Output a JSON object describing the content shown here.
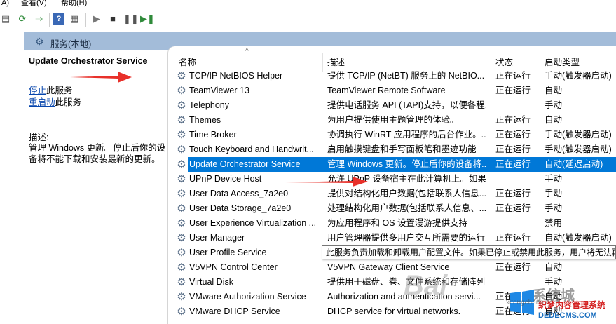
{
  "menu": {
    "action": "A)",
    "view": "查看(V)",
    "help": "帮助(H)"
  },
  "panel": {
    "header_title": "服务(本地)",
    "selected_service": "Update Orchestrator Service",
    "stop_link": "停止",
    "stop_suffix": "此服务",
    "restart_link": "重启动",
    "restart_suffix": "此服务",
    "desc_label": "描述:",
    "desc_text": "管理 Windows 更新。停止后你的设备将不能下载和安装最新的更新。"
  },
  "columns": {
    "name": "名称",
    "desc": "描述",
    "status": "状态",
    "startup": "启动类型"
  },
  "services": [
    {
      "name": "TCP/IP NetBIOS Helper",
      "desc": "提供 TCP/IP (NetBT) 服务上的 NetBIO...",
      "status": "正在运行",
      "startup": "手动(触发器启动)"
    },
    {
      "name": "TeamViewer 13",
      "desc": "TeamViewer Remote Software",
      "status": "正在运行",
      "startup": "自动"
    },
    {
      "name": "Telephony",
      "desc": "提供电话服务 API (TAPI)支持，以便各程...",
      "status": "",
      "startup": "手动"
    },
    {
      "name": "Themes",
      "desc": "为用户提供使用主题管理的体验。",
      "status": "正在运行",
      "startup": "自动"
    },
    {
      "name": "Time Broker",
      "desc": "协调执行 WinRT 应用程序的后台作业。...",
      "status": "正在运行",
      "startup": "手动(触发器启动)"
    },
    {
      "name": "Touch Keyboard and Handwrit...",
      "desc": "启用触摸键盘和手写面板笔和墨迹功能",
      "status": "正在运行",
      "startup": "手动(触发器启动)"
    },
    {
      "name": "Update Orchestrator Service",
      "desc": "管理 Windows 更新。停止后你的设备将...",
      "status": "正在运行",
      "startup": "自动(延迟启动)"
    },
    {
      "name": "UPnP Device Host",
      "desc": "允许 UPnP 设备宿主在此计算机上。如果...",
      "status": "",
      "startup": "手动"
    },
    {
      "name": "User Data Access_7a2e0",
      "desc": "提供对结构化用户数据(包括联系人信息...",
      "status": "正在运行",
      "startup": "手动"
    },
    {
      "name": "User Data Storage_7a2e0",
      "desc": "处理结构化用户数据(包括联系人信息、...",
      "status": "正在运行",
      "startup": "手动"
    },
    {
      "name": "User Experience Virtualization ...",
      "desc": "为应用程序和 OS 设置漫游提供支持",
      "status": "",
      "startup": "禁用"
    },
    {
      "name": "User Manager",
      "desc": "用户管理器提供多用户交互所需要的运行...",
      "status": "正在运行",
      "startup": "自动(触发器启动)"
    },
    {
      "name": "User Profile Service",
      "desc": "",
      "status": "",
      "startup": ""
    },
    {
      "name": "V5VPN Control Center",
      "desc": "V5VPN Gateway Client Service",
      "status": "正在运行",
      "startup": "自动"
    },
    {
      "name": "Virtual Disk",
      "desc": "提供用于磁盘、卷、文件系统和存储阵列...",
      "status": "",
      "startup": "手动"
    },
    {
      "name": "VMware Authorization Service",
      "desc": "Authorization and authentication servi...",
      "status": "正在运行",
      "startup": "自动"
    },
    {
      "name": "VMware DHCP Service",
      "desc": "DHCP service for virtual networks.",
      "status": "正在运行",
      "startup": "自动"
    }
  ],
  "tooltip": "此服务负责加载和卸载用户配置文件。如果已停止或禁用此服务，用户将无法再",
  "watermark": {
    "baidu": "Bai",
    "xitong": "系统城",
    "site1": "织梦内容管理系统",
    "site2": "DEDECMS.COM",
    "sub": "xitongcheng.com"
  },
  "colors": {
    "header_bar": "#a3bcd9",
    "selection": "#0078d7",
    "link": "#0645ad",
    "arrow": "#e8302a"
  },
  "icons": {
    "service": "gear-icon"
  }
}
